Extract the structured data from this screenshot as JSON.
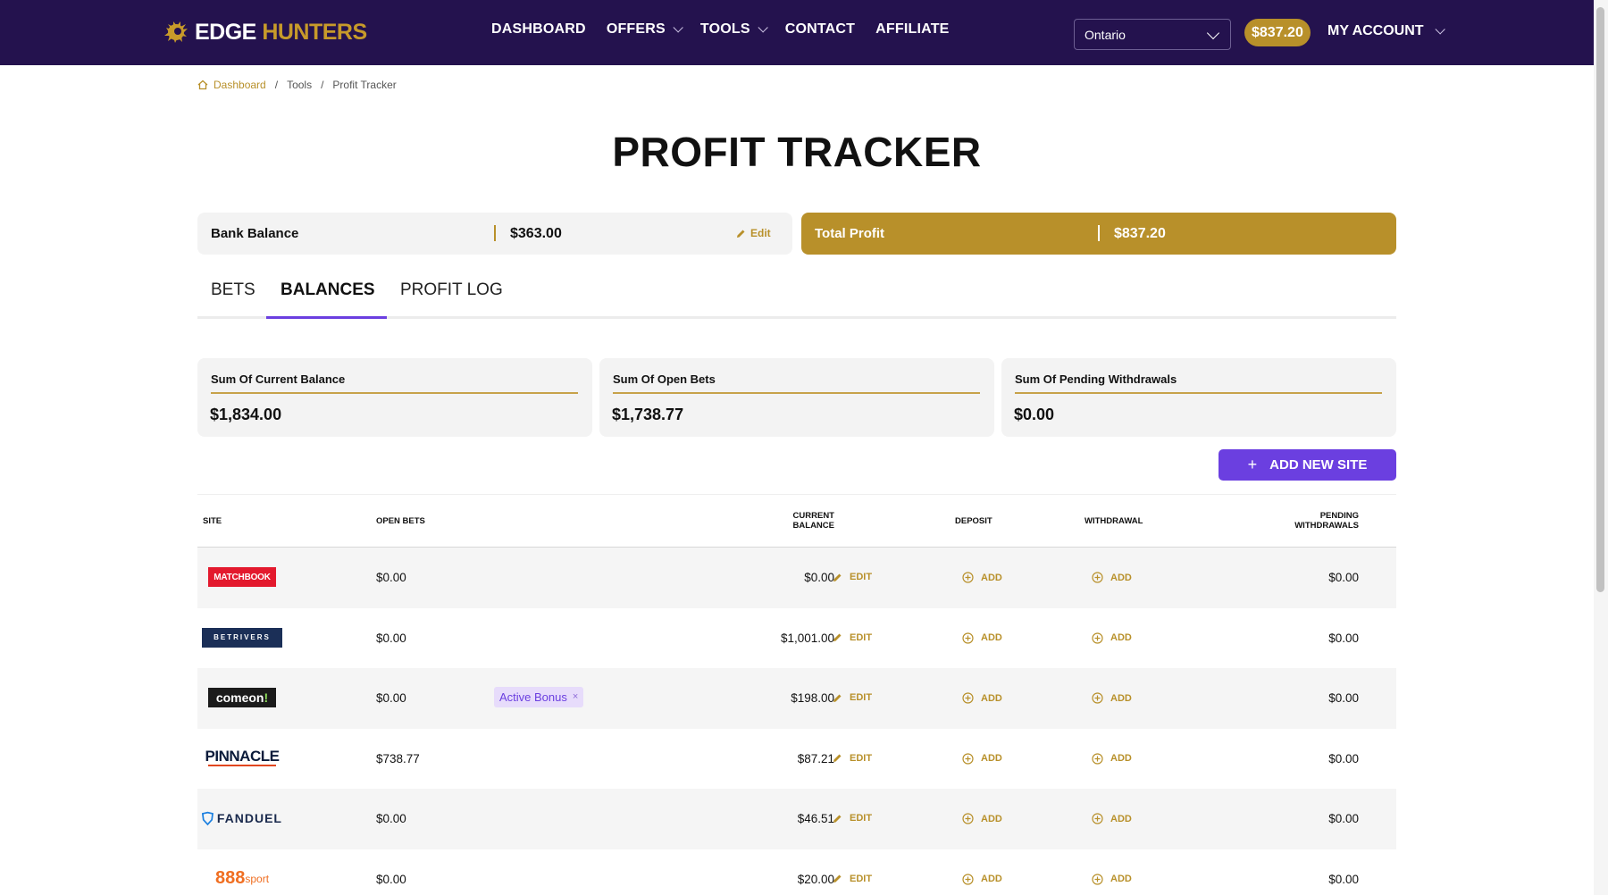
{
  "brand": {
    "word1": "EDGE",
    "word2": "HUNTERS",
    "accent": "#c79a2a",
    "nav_bg": "#24124e",
    "primary": "#6b3fe0"
  },
  "nav": {
    "links": [
      "DASHBOARD",
      "OFFERS",
      "TOOLS",
      "CONTACT",
      "AFFILIATE"
    ],
    "region": "Ontario",
    "balance": "$837.20",
    "account": "MY ACCOUNT"
  },
  "breadcrumb": {
    "home": "Dashboard",
    "tools": "Tools",
    "current": "Profit Tracker",
    "sep": "/"
  },
  "title": "PROFIT TRACKER",
  "bank": {
    "label": "Bank Balance",
    "value": "$363.00",
    "edit": "Edit"
  },
  "profit": {
    "label": "Total Profit",
    "value": "$837.20"
  },
  "tabs": [
    {
      "label": "BETS",
      "active": false
    },
    {
      "label": "BALANCES",
      "active": true
    },
    {
      "label": "PROFIT LOG",
      "active": false
    }
  ],
  "sums": [
    {
      "label": "Sum Of Current Balance",
      "value": "$1,834.00"
    },
    {
      "label": "Sum Of Open Bets",
      "value": "$1,738.77"
    },
    {
      "label": "Sum Of Pending Withdrawals",
      "value": "$0.00"
    }
  ],
  "add_site": {
    "plus": "+",
    "label": "ADD NEW SITE"
  },
  "table": {
    "headers": {
      "site": "SITE",
      "open_bets": "OPEN BETS",
      "current_balance_1": "CURRENT",
      "current_balance_2": "BALANCE",
      "deposit": "DEPOSIT",
      "withdrawal": "WITHDRAWAL",
      "pending_1": "PENDING",
      "pending_2": "WITHDRAWALS"
    },
    "edit_label": "EDIT",
    "add_label": "ADD",
    "rows": [
      {
        "site": "MATCHBOOK",
        "open_bets": "$0.00",
        "balance": "$0.00",
        "pending": "$0.00"
      },
      {
        "site": "BETRIVERS",
        "open_bets": "$0.00",
        "balance": "$1,001.00",
        "pending": "$0.00"
      },
      {
        "site": "comeon",
        "site_mark": "!",
        "open_bets": "$0.00",
        "bonus": "Active Bonus",
        "bonus_close": "×",
        "balance": "$198.00",
        "pending": "$0.00"
      },
      {
        "site": "PINNACLE",
        "open_bets": "$738.77",
        "balance": "$87.21",
        "pending": "$0.00"
      },
      {
        "site": "FANDUEL",
        "open_bets": "$0.00",
        "balance": "$46.51",
        "pending": "$0.00"
      },
      {
        "site": "888",
        "site_sub": "sport",
        "open_bets": "$0.00",
        "balance": "$20.00",
        "pending": "$0.00"
      }
    ]
  }
}
